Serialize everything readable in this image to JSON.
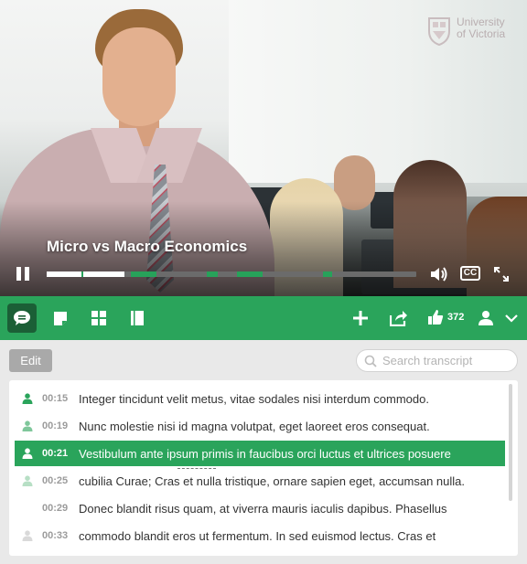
{
  "video": {
    "title": "Micro vs Macro Economics",
    "logo_line1": "University",
    "logo_line2": "of Victoria",
    "progress_played_fraction": 0.21
  },
  "toolbar": {
    "tabs": [
      {
        "name": "transcript-tab",
        "icon": "chat-bubble-icon",
        "active": true
      },
      {
        "name": "notes-tab",
        "icon": "note-icon",
        "active": false
      },
      {
        "name": "grid-tab",
        "icon": "grid-icon",
        "active": false
      },
      {
        "name": "book-tab",
        "icon": "book-icon",
        "active": false
      }
    ],
    "likes_count": "372"
  },
  "transcript": {
    "edit_label": "Edit",
    "search_placeholder": "Search transcript",
    "rows": [
      {
        "time": "00:15",
        "text": "Integer tincidunt velit metus, vitae sodales nisi interdum commodo.",
        "speaker_color": "#2aa45b",
        "active": false
      },
      {
        "time": "00:19",
        "text": "Nunc molestie nisi id magna volutpat, eget laoreet eros consequat.",
        "speaker_color": "#7fc79b",
        "active": false
      },
      {
        "time": "00:21",
        "text": "Vestibulum ante ipsum primis in faucibus orci luctus et ultrices posuere",
        "speaker_color": "#ffffff",
        "active": true
      },
      {
        "time": "00:25",
        "text": "cubilia Curae; Cras et nulla tristique, ornare sapien eget, accumsan nulla.",
        "speaker_color": "#b7dfc5",
        "active": false
      },
      {
        "time": "00:29",
        "text": "Donec blandit risus quam, at viverra mauris iaculis dapibus. Phasellus",
        "speaker_color": "",
        "active": false
      },
      {
        "time": "00:33",
        "text": "commodo blandit eros ut fermentum. In sed euismod lectus. Cras et",
        "speaker_color": "#d9d9d9",
        "active": false
      }
    ]
  },
  "colors": {
    "accent": "#2aa45b",
    "accent_dark": "#1b5f36"
  }
}
